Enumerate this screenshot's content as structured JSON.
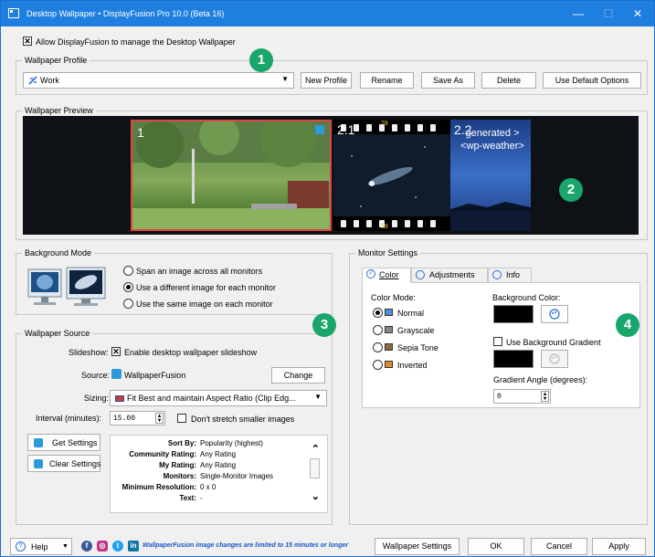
{
  "window": {
    "title": "Desktop Wallpaper • DisplayFusion Pro 10.0 (Beta 16)"
  },
  "allow_manage": {
    "label": "Allow DisplayFusion to manage the Desktop Wallpaper",
    "checked": true
  },
  "profile": {
    "group_title": "Wallpaper Profile",
    "selected": "Work",
    "buttons": {
      "new": "New Profile",
      "rename": "Rename",
      "save_as": "Save As",
      "delete": "Delete",
      "default": "Use Default Options"
    }
  },
  "preview": {
    "group_title": "Wallpaper Preview",
    "monitors": [
      "1",
      "2.1",
      "2.2"
    ],
    "weather_text": "generated > <wp-weather>",
    "film_numbers": [
      "28",
      "28",
      "29"
    ]
  },
  "background_mode": {
    "group_title": "Background Mode",
    "options": [
      {
        "label": "Span an image across all monitors",
        "selected": false
      },
      {
        "label": "Use a different image for each monitor",
        "selected": true
      },
      {
        "label": "Use the same image on each monitor",
        "selected": false
      }
    ]
  },
  "source": {
    "group_title": "Wallpaper Source",
    "slideshow_label": "Slideshow:",
    "slideshow_checkbox": "Enable desktop wallpaper slideshow",
    "source_label": "Source:",
    "source_value": "WallpaperFusion",
    "change_button": "Change",
    "sizing_label": "Sizing:",
    "sizing_value": "Fit Best and maintain Aspect Ratio (Clip Edg...",
    "interval_label": "Interval (minutes):",
    "interval_value": "15.00",
    "dont_stretch": "Don't stretch smaller images",
    "get_settings": "Get Settings",
    "clear_settings": "Clear Settings",
    "info": [
      {
        "key": "Sort By:",
        "value": "Popularity (highest)"
      },
      {
        "key": "Community Rating:",
        "value": "Any Rating"
      },
      {
        "key": "My Rating:",
        "value": "Any Rating"
      },
      {
        "key": "Monitors:",
        "value": "Single-Monitor Images"
      },
      {
        "key": "Minimum Resolution:",
        "value": "0 x 0"
      },
      {
        "key": "Text:",
        "value": "-"
      }
    ]
  },
  "monitor_settings": {
    "group_title": "Monitor Settings",
    "tabs": [
      "Color",
      "Adjustments",
      "Info"
    ],
    "color_mode_label": "Color Mode:",
    "color_modes": [
      {
        "label": "Normal",
        "selected": true
      },
      {
        "label": "Grayscale",
        "selected": false
      },
      {
        "label": "Sepia Tone",
        "selected": false
      },
      {
        "label": "Inverted",
        "selected": false
      }
    ],
    "bg_color_label": "Background Color:",
    "bg_color": "#000000",
    "use_gradient": "Use Background Gradient",
    "gradient_angle_label": "Gradient Angle (degrees):",
    "gradient_angle": "0"
  },
  "badges": [
    "1",
    "2",
    "3",
    "4"
  ],
  "footer": {
    "help": "Help",
    "notice": "WallpaperFusion image changes are limited to 15 minutes or longer",
    "wallpaper_settings": "Wallpaper Settings",
    "ok": "OK",
    "cancel": "Cancel",
    "apply": "Apply"
  },
  "colors": {
    "titlebar": "#1f7fe0",
    "badge": "#1aa56d",
    "notice": "#1a56c8",
    "selected_monitor": "#e04545"
  }
}
